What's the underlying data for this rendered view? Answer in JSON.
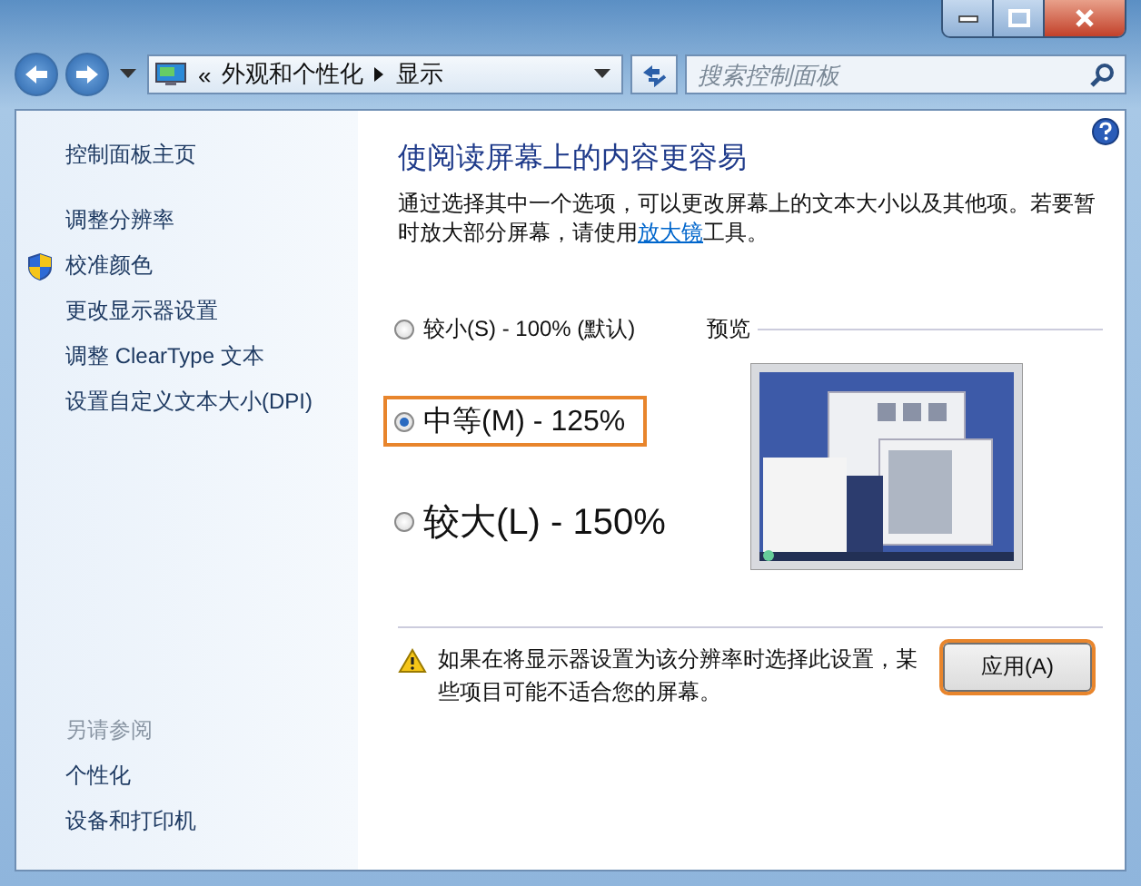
{
  "address_bar": {
    "separator": "«",
    "breadcrumbs": [
      "外观和个性化",
      "显示"
    ]
  },
  "search": {
    "placeholder": "搜索控制面板"
  },
  "sidebar": {
    "items": [
      {
        "label": "控制面板主页",
        "kind": "home"
      },
      {
        "label": "调整分辨率",
        "kind": "link"
      },
      {
        "label": "校准颜色",
        "kind": "admin"
      },
      {
        "label": "更改显示器设置",
        "kind": "link"
      },
      {
        "label": "调整 ClearType 文本",
        "kind": "link"
      },
      {
        "label": "设置自定义文本大小(DPI)",
        "kind": "link"
      }
    ],
    "see_also": {
      "heading": "另请参阅",
      "items": [
        "个性化",
        "设备和打印机"
      ]
    }
  },
  "main": {
    "title": "使阅读屏幕上的内容更容易",
    "description": "通过选择其中一个选项，可以更改屏幕上的文本大小以及其他项。若要暂时放大部分屏幕，请使用",
    "link": "放大镜",
    "description_end": "工具。",
    "options": [
      {
        "label": "较小(S) - 100% (默认)",
        "kind": "small",
        "selected": false,
        "highlighted": false
      },
      {
        "label": "中等(M) - 125%",
        "kind": "medium",
        "selected": true,
        "highlighted": true
      },
      {
        "label": "较大(L) - 150%",
        "kind": "large",
        "selected": false,
        "highlighted": false
      }
    ],
    "preview_label": "预览",
    "warning": "如果在将显示器设置为该分辨率时选择此设置，某些项目可能不适合您的屏幕。",
    "apply_button": {
      "label": "应用(A)",
      "highlighted": true
    }
  }
}
